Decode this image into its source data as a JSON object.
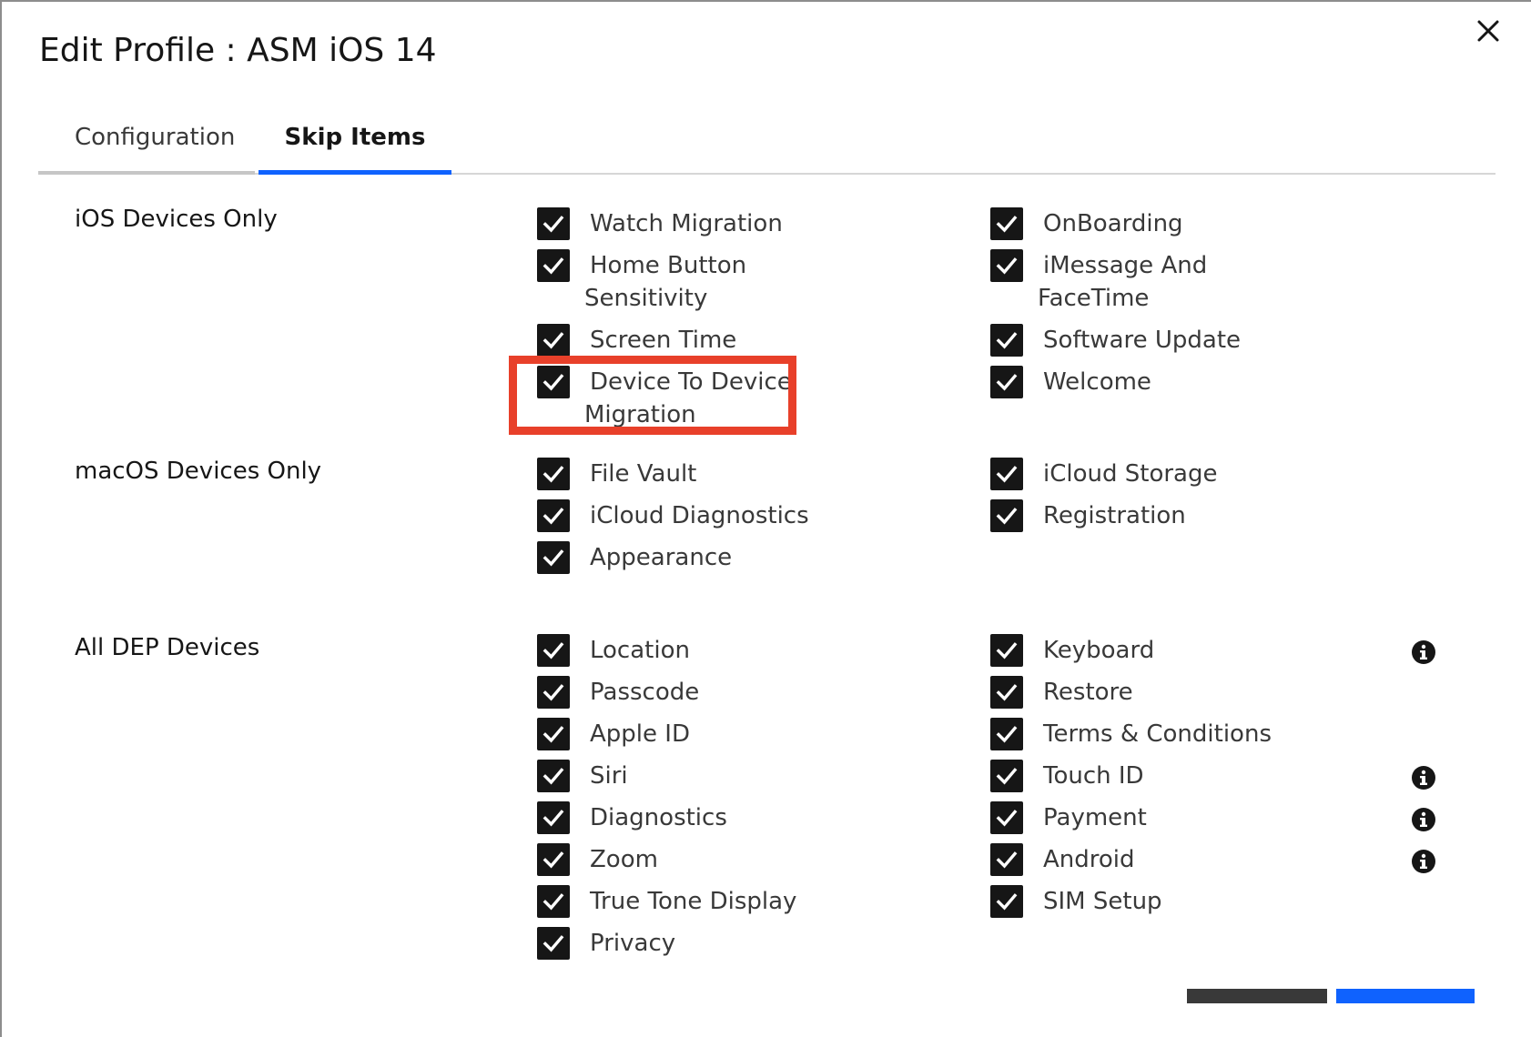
{
  "dialog": {
    "title": "Edit Profile : ASM iOS 14"
  },
  "tabs": [
    {
      "label": "Configuration",
      "selected": false
    },
    {
      "label": "Skip Items",
      "selected": true
    }
  ],
  "sections": {
    "ios": {
      "label": "iOS Devices Only",
      "col1": [
        {
          "line1": "Watch Migration",
          "line2": "",
          "checked": true
        },
        {
          "line1": "Home Button",
          "line2": "Sensitivity",
          "checked": true
        },
        {
          "line1": "Screen Time",
          "line2": "",
          "checked": true
        },
        {
          "line1": "Device To Device",
          "line2": "Migration",
          "checked": true
        }
      ],
      "col2": [
        {
          "line1": "OnBoarding",
          "line2": "",
          "checked": true
        },
        {
          "line1": "iMessage And",
          "line2": "FaceTime",
          "checked": true
        },
        {
          "line1": "Software Update",
          "line2": "",
          "checked": true
        },
        {
          "line1": "Welcome",
          "line2": "",
          "checked": true
        }
      ]
    },
    "macos": {
      "label": "macOS Devices Only",
      "col1": [
        {
          "line1": "File Vault",
          "checked": true
        },
        {
          "line1": "iCloud Diagnostics",
          "checked": true
        },
        {
          "line1": "Appearance",
          "checked": true
        }
      ],
      "col2": [
        {
          "line1": "iCloud Storage",
          "checked": true
        },
        {
          "line1": "Registration",
          "checked": true
        }
      ]
    },
    "all": {
      "label": "All DEP Devices",
      "col1": [
        {
          "line1": "Location",
          "checked": true
        },
        {
          "line1": "Passcode",
          "checked": true
        },
        {
          "line1": "Apple ID",
          "checked": true
        },
        {
          "line1": "Siri",
          "checked": true
        },
        {
          "line1": "Diagnostics",
          "checked": true
        },
        {
          "line1": "Zoom",
          "checked": true
        },
        {
          "line1": "True Tone Display",
          "checked": true
        },
        {
          "line1": "Privacy",
          "checked": true
        }
      ],
      "col2": [
        {
          "line1": "Keyboard",
          "checked": true,
          "info": true
        },
        {
          "line1": "Restore",
          "checked": true,
          "info": false
        },
        {
          "line1": "Terms & Conditions",
          "checked": true,
          "info": false
        },
        {
          "line1": "Touch ID",
          "checked": true,
          "info": true
        },
        {
          "line1": "Payment",
          "checked": true,
          "info": true
        },
        {
          "line1": "Android",
          "checked": true,
          "info": true
        },
        {
          "line1": "SIM Setup",
          "checked": true,
          "info": false
        }
      ]
    }
  },
  "icons": {
    "close": "close-icon",
    "checkbox": "checkmark-icon",
    "info": "information-icon"
  },
  "colors": {
    "accent": "#0f62fe",
    "highlight": "#e8402a",
    "checkbox": "#161616"
  }
}
